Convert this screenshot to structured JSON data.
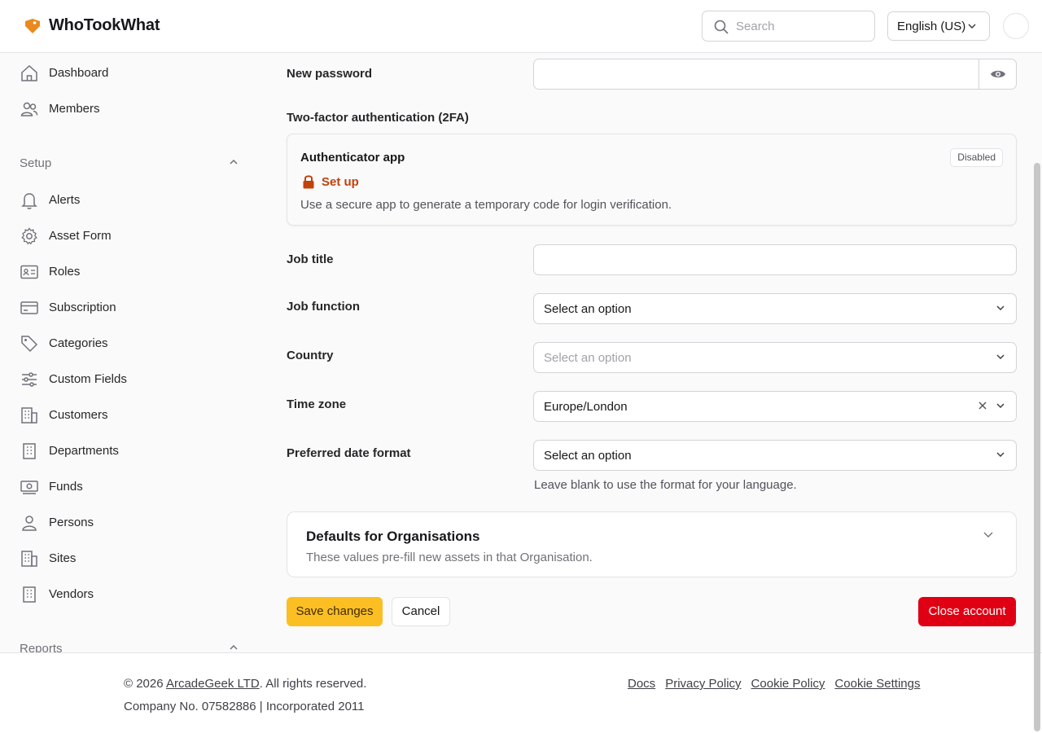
{
  "header": {
    "brand": "WhoTookWhat",
    "search_placeholder": "Search",
    "language": "English (US)"
  },
  "sidebar": {
    "top_items": [
      {
        "label": "Dashboard",
        "icon": "home-icon"
      },
      {
        "label": "Members",
        "icon": "users-icon"
      }
    ],
    "setup_title": "Setup",
    "setup_items": [
      {
        "label": "Alerts",
        "icon": "bell-icon"
      },
      {
        "label": "Asset Form",
        "icon": "gear-icon"
      },
      {
        "label": "Roles",
        "icon": "id-card-icon"
      },
      {
        "label": "Subscription",
        "icon": "credit-card-icon"
      },
      {
        "label": "Categories",
        "icon": "tag-icon"
      },
      {
        "label": "Custom Fields",
        "icon": "sliders-icon"
      },
      {
        "label": "Customers",
        "icon": "building-icon"
      },
      {
        "label": "Departments",
        "icon": "building-icon"
      },
      {
        "label": "Funds",
        "icon": "money-icon"
      },
      {
        "label": "Persons",
        "icon": "person-icon"
      },
      {
        "label": "Sites",
        "icon": "building-icon"
      },
      {
        "label": "Vendors",
        "icon": "building-icon"
      }
    ],
    "reports_title": "Reports"
  },
  "form": {
    "new_password_label": "New password",
    "twofa_label": "Two-factor authentication (2FA)",
    "twofa": {
      "title": "Authenticator app",
      "badge": "Disabled",
      "setup_link": "Set up",
      "description": "Use a secure app to generate a temporary code for login verification."
    },
    "job_title_label": "Job title",
    "job_function_label": "Job function",
    "job_function_value": "Select an option",
    "country_label": "Country",
    "country_placeholder": "Select an option",
    "timezone_label": "Time zone",
    "timezone_value": "Europe/London",
    "date_format_label": "Preferred date format",
    "date_format_value": "Select an option",
    "date_format_hint": "Leave blank to use the format for your language."
  },
  "defaults": {
    "title": "Defaults for Organisations",
    "description": "These values pre-fill new assets in that Organisation."
  },
  "actions": {
    "save": "Save changes",
    "cancel": "Cancel",
    "close_account": "Close account"
  },
  "footer": {
    "copyright_prefix": "© 2026 ",
    "company": "ArcadeGeek LTD",
    "copyright_suffix": ". All rights reserved.",
    "company_info": "Company No. 07582886 | Incorporated 2011",
    "links": [
      "Docs",
      "Privacy Policy",
      "Cookie Policy",
      "Cookie Settings"
    ]
  },
  "colors": {
    "accent": "#fbbf24",
    "danger": "#e00013",
    "link": "#c2410c"
  }
}
